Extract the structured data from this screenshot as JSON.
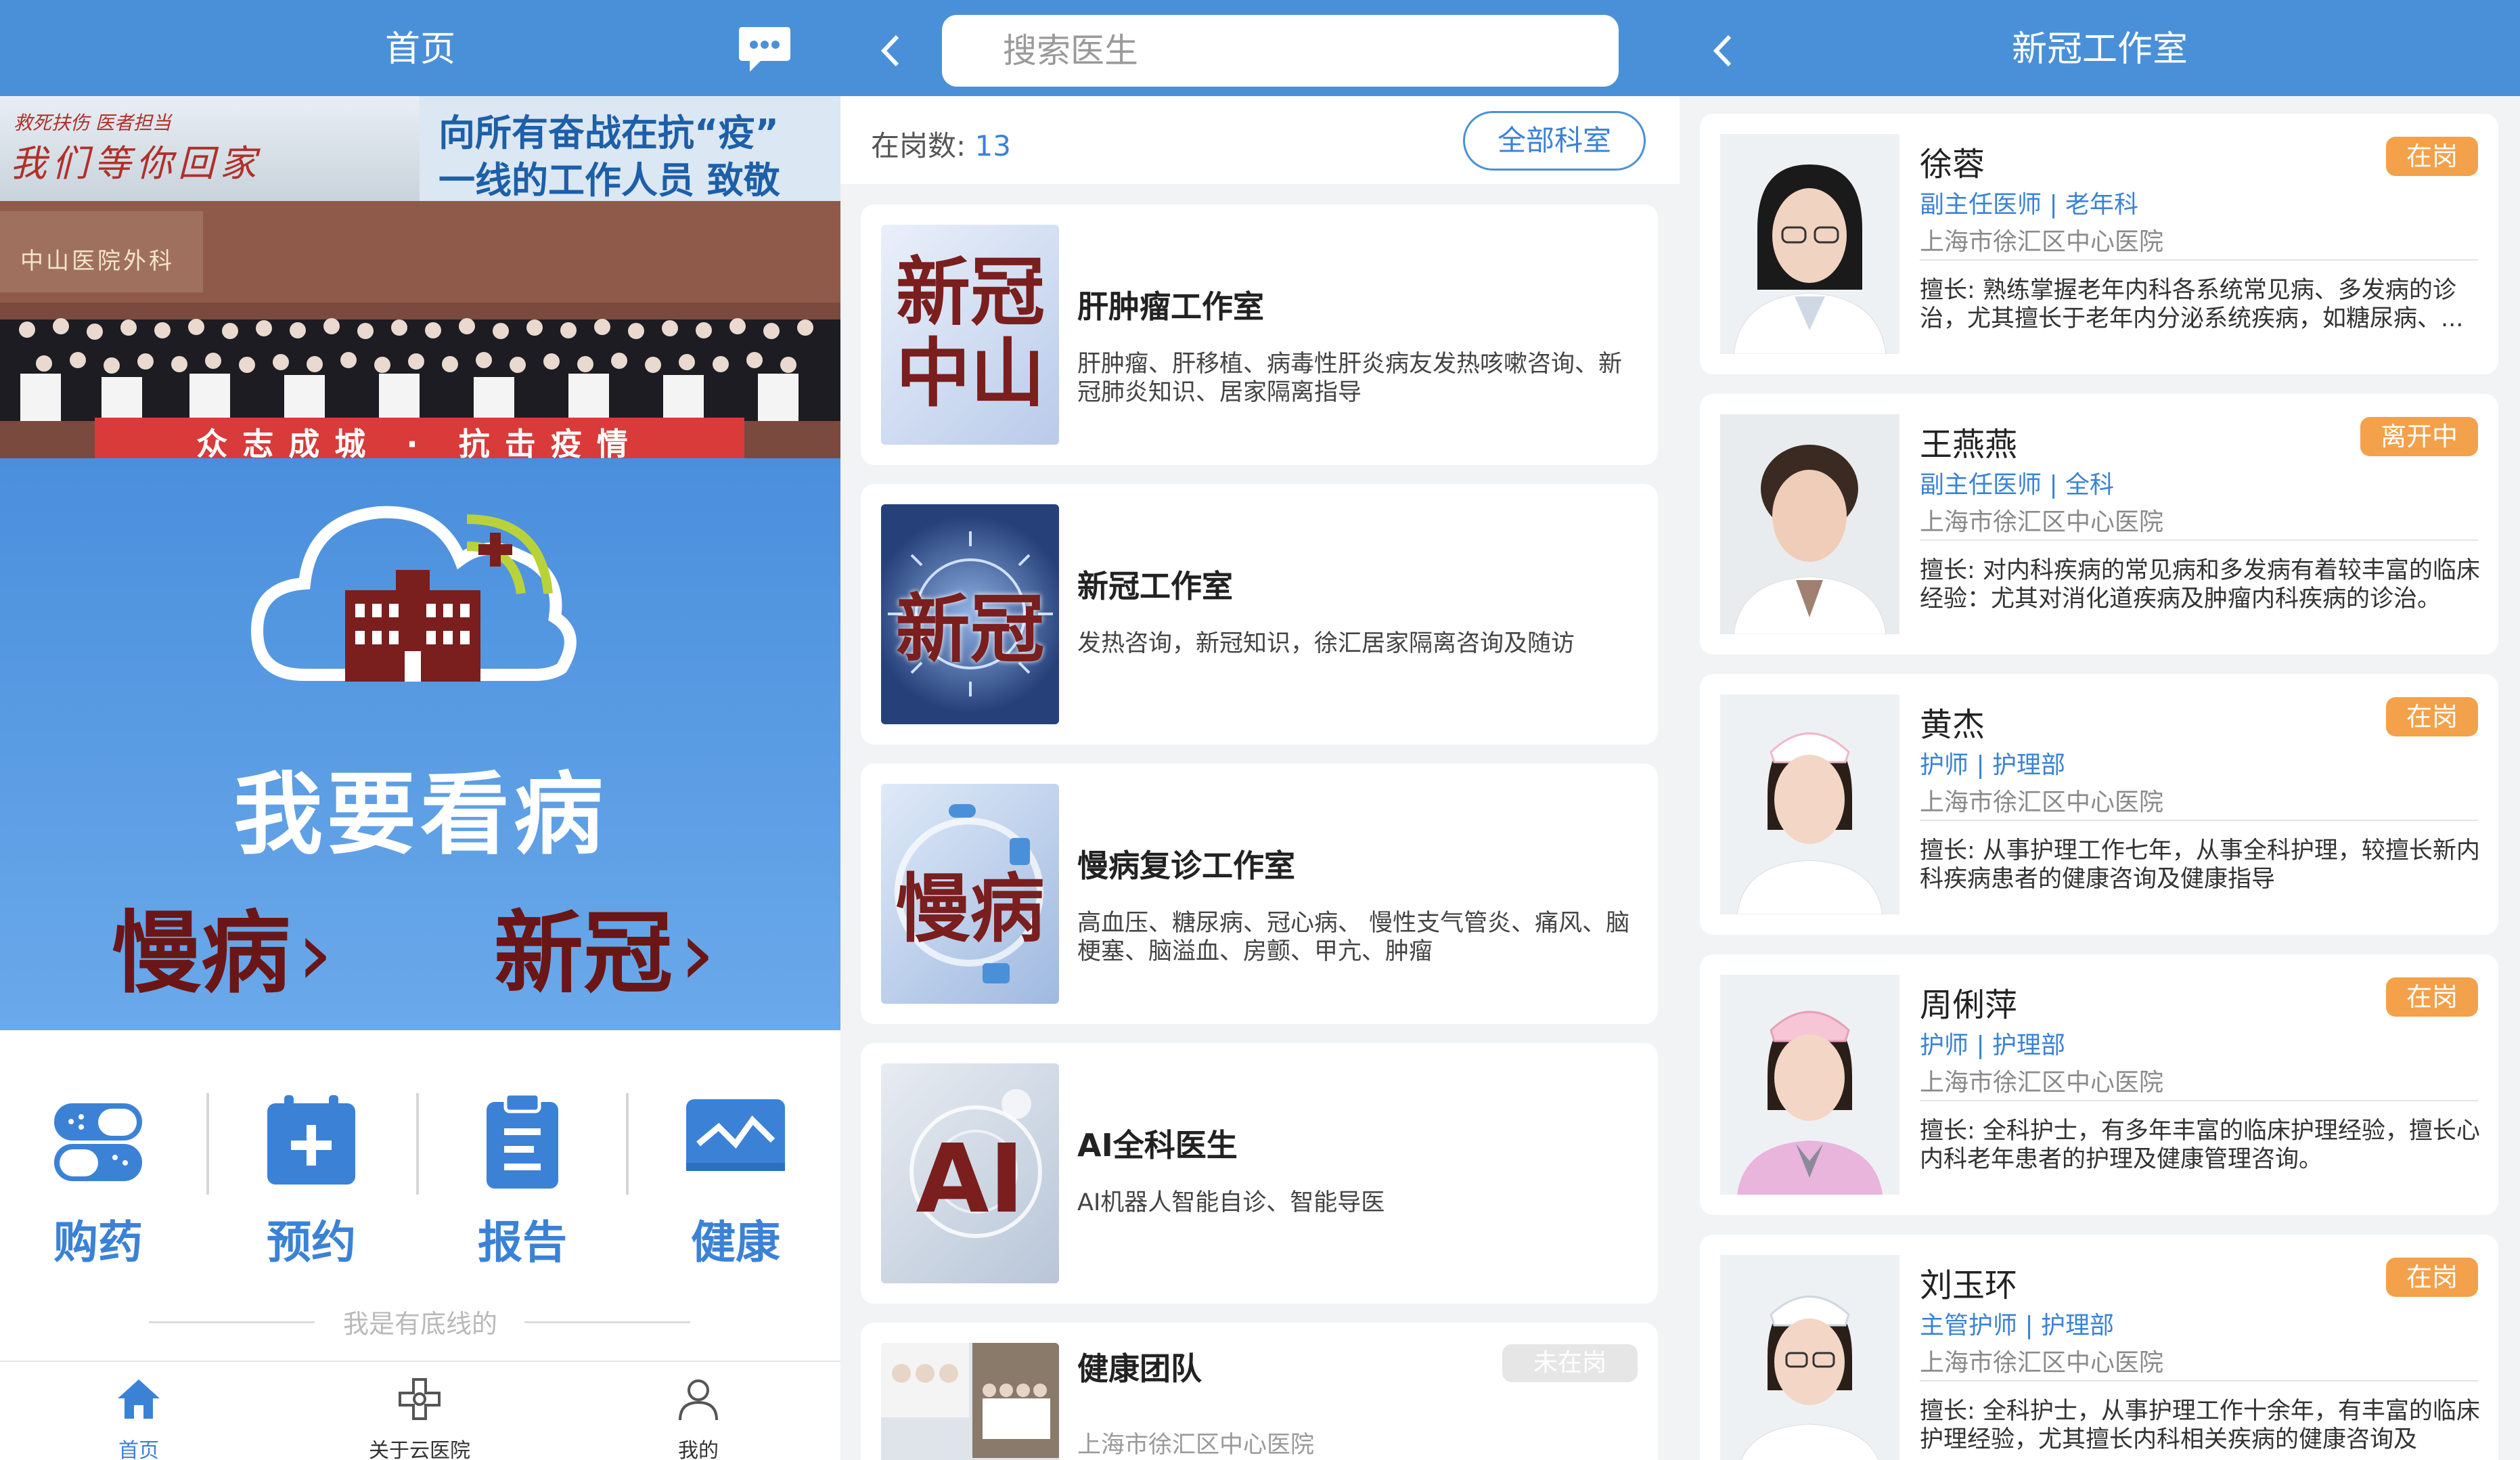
{
  "screen1": {
    "title": "首页",
    "banner_slogan_line1": "向所有奋战在抗“疫”",
    "banner_slogan_line2": "一线的工作人员 致敬",
    "banner_calligraphy": "我们等你回家",
    "banner_calligraphy_small": "救死扶伤 医者担当",
    "banner_ribbon": "众志成城 · 抗击疫情",
    "banner_building_text": "中山医院外科",
    "hero_main": "我要看病",
    "hero_btn_chronic": "慢病",
    "hero_btn_covid": "新冠",
    "hero_arrow": "›",
    "quick": [
      {
        "label": "购药",
        "icon": "pill-icon"
      },
      {
        "label": "预约",
        "icon": "calendar-plus-icon"
      },
      {
        "label": "报告",
        "icon": "report-icon"
      },
      {
        "label": "健康",
        "icon": "health-monitor-icon"
      }
    ],
    "footer_note": "我是有底线的",
    "tabs": [
      {
        "label": "首页",
        "icon": "home-icon"
      },
      {
        "label": "关于云医院",
        "icon": "hospital-icon"
      },
      {
        "label": "我的",
        "icon": "user-icon"
      }
    ]
  },
  "screen2": {
    "search_placeholder": "搜索医生",
    "onduty_label": "在岗数:",
    "onduty_count": "13",
    "dept_button": "全部科室",
    "cards": [
      {
        "thumb_text": "新冠中山",
        "name": "肝肿瘤工作室",
        "desc": "肝肿瘤、肝移植、病毒性肝炎病友发热咳嗽咨询、新冠肺炎知识、居家隔离指导"
      },
      {
        "thumb_text": "新冠",
        "name": "新冠工作室",
        "desc": "发热咨询，新冠知识，徐汇居家隔离咨询及随访"
      },
      {
        "thumb_text": "慢病",
        "name": "慢病复诊工作室",
        "desc": "高血压、糖尿病、冠心病、 慢性支气管炎、痛风、脑梗塞、脑溢血、房颤、甲亢、肿瘤"
      },
      {
        "thumb_text": "AI",
        "name": "AI全科医生",
        "desc": "AI机器人智能自诊、智能导医"
      },
      {
        "name": "健康团队",
        "desc": "上海市徐汇区中心医院",
        "status": "未在岗"
      }
    ]
  },
  "screen3": {
    "title": "新冠工作室",
    "doctors": [
      {
        "name": "徐蓉",
        "title": "副主任医师 | 老年科",
        "hospital": "上海市徐汇区中心医院",
        "skill": "擅长: 熟练掌握老年内科各系统常见病、多发病的诊治，尤其擅长于老年内分泌系统疾病，如糖尿病、...",
        "status": "在岗"
      },
      {
        "name": "王燕燕",
        "title": "副主任医师 | 全科",
        "hospital": "上海市徐汇区中心医院",
        "skill": "擅长: 对内科疾病的常见病和多发病有着较丰富的临床经验：尤其对消化道疾病及肿瘤内科疾病的诊治。",
        "status": "离开中"
      },
      {
        "name": "黄杰",
        "title": "护师 | 护理部",
        "hospital": "上海市徐汇区中心医院",
        "skill": "擅长: 从事护理工作七年，从事全科护理，较擅长新内科疾病患者的健康咨询及健康指导",
        "status": "在岗"
      },
      {
        "name": "周俐萍",
        "title": "护师 | 护理部",
        "hospital": "上海市徐汇区中心医院",
        "skill": "擅长: 全科护士，有多年丰富的临床护理经验，擅长心内科老年患者的护理及健康管理咨询。",
        "status": "在岗"
      },
      {
        "name": "刘玉环",
        "title": "主管护师 | 护理部",
        "hospital": "上海市徐汇区中心医院",
        "skill": "擅长: 全科护士，从事护理工作十余年，有丰富的临床护理经验，尤其擅长内科相关疾病的健康咨询及",
        "status": "在岗"
      }
    ]
  }
}
